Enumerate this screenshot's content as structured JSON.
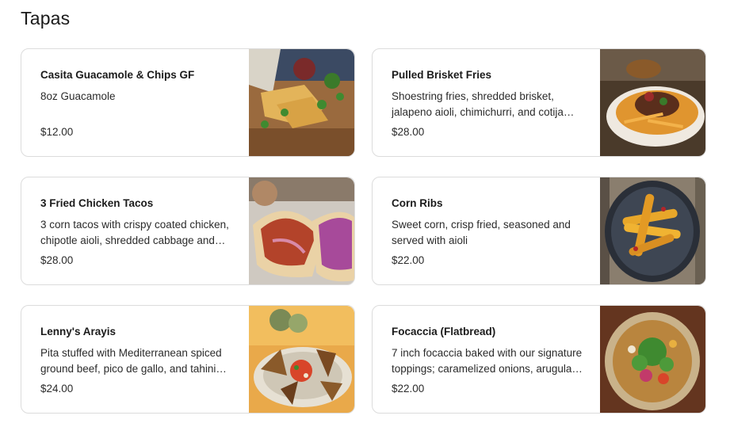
{
  "section": {
    "title": "Tapas"
  },
  "items": [
    {
      "name": "Casita Guacamole & Chips GF",
      "description": "8oz Guacamole",
      "price": "$12.00",
      "photo_icon": "guacamole-chips-photo"
    },
    {
      "name": "Pulled Brisket Fries",
      "description": "Shoestring fries, shredded brisket, jalapeno aioli, chimichurri, and cotija cheese",
      "price": "$28.00",
      "photo_icon": "brisket-fries-photo"
    },
    {
      "name": "3 Fried Chicken Tacos",
      "description": "3 corn tacos with crispy coated chicken, chipotle aioli, shredded cabbage and pickled onions",
      "price": "$28.00",
      "photo_icon": "chicken-tacos-photo"
    },
    {
      "name": "Corn Ribs",
      "description": "Sweet corn, crisp fried, seasoned and served with aioli",
      "price": "$22.00",
      "photo_icon": "corn-ribs-photo"
    },
    {
      "name": "Lenny's Arayis",
      "description": "Pita stuffed with Mediterranean spiced ground beef, pico de gallo, and tahini sauce",
      "price": "$24.00",
      "photo_icon": "arayis-photo"
    },
    {
      "name": "Focaccia (Flatbread)",
      "description": "7 inch focaccia baked with our signature toppings; caramelized onions, arugula and peppers",
      "price": "$22.00",
      "photo_icon": "focaccia-photo"
    }
  ]
}
